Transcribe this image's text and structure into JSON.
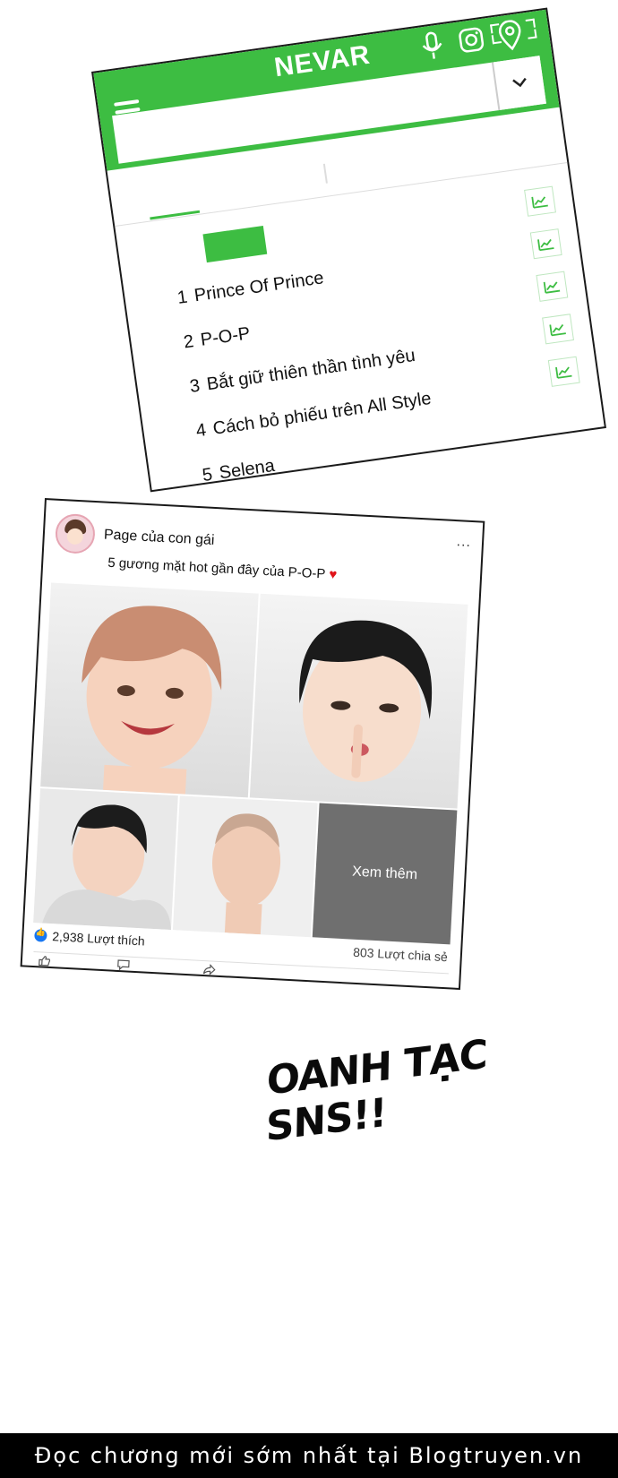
{
  "app": {
    "title": "NEVAR",
    "search_value": "",
    "icons": [
      "menu-icon",
      "fullscreen-icon",
      "microphone-icon",
      "instagram-icon",
      "location-pin-icon",
      "chevron-down-icon",
      "trend-icon"
    ],
    "accent_color": "#3dbd42"
  },
  "ranking": [
    {
      "rank": "1",
      "label": "Prince Of Prince"
    },
    {
      "rank": "2",
      "label": "P-O-P"
    },
    {
      "rank": "3",
      "label": "Bắt giữ thiên thần tình yêu"
    },
    {
      "rank": "4",
      "label": "Cách bỏ phiếu trên All Style"
    },
    {
      "rank": "5",
      "label": "Selena"
    }
  ],
  "post": {
    "page_name": "Page của con gái",
    "more": "...",
    "caption": "5 gương mặt hot gần đây của P-O-P",
    "see_more": "Xem thêm",
    "likes": "2,938 Lượt thích",
    "shares": "803 Lượt chia sẻ",
    "heart_color": "#e0141a"
  },
  "shout": "OANH TẠC SNS!!",
  "footer": "Đọc chương mới sớm nhất tại Blogtruyen.vn"
}
